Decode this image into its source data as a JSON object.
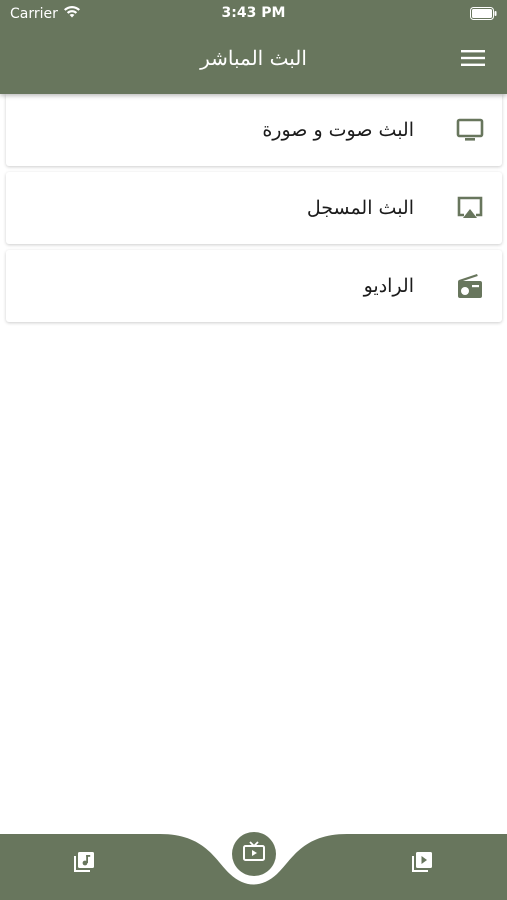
{
  "status_bar": {
    "carrier": "Carrier",
    "time": "3:43 PM"
  },
  "header": {
    "title": "البث المباشر",
    "menu_icon": "hamburger-menu-icon"
  },
  "list": {
    "items": [
      {
        "label": "البث صوت و صورة",
        "icon": "tv-icon"
      },
      {
        "label": "البث المسجل",
        "icon": "airplay-icon"
      },
      {
        "label": "الراديو",
        "icon": "radio-icon"
      }
    ]
  },
  "bottom_nav": {
    "left_icon": "music-library-icon",
    "center_icon": "live-tv-icon",
    "right_icon": "video-library-icon"
  },
  "colors": {
    "primary": "#68765d",
    "icon": "#68765d",
    "background": "#ffffff",
    "text": "#1b1b1b"
  }
}
